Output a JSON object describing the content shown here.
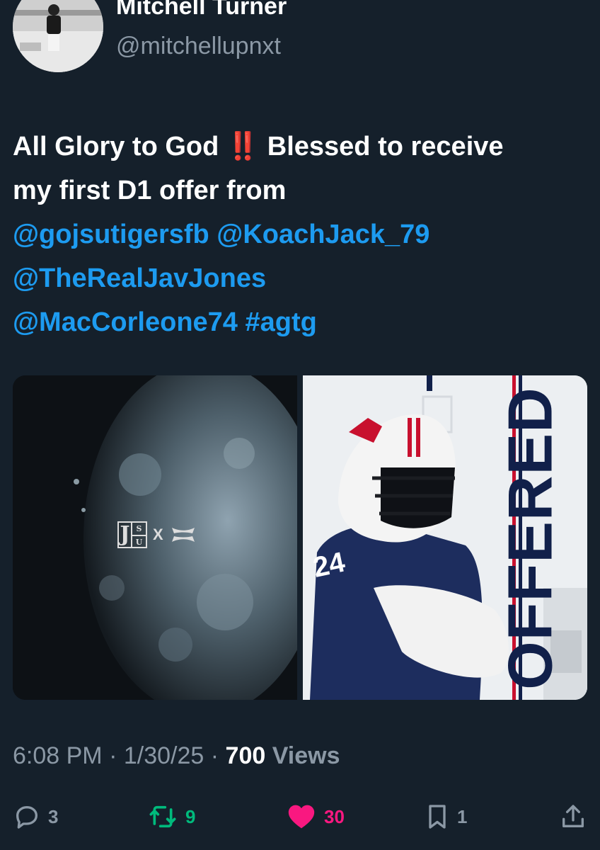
{
  "author": {
    "display_name": "Mitchell Turner",
    "handle": "@mitchellupnxt"
  },
  "tweet": {
    "line1_a": "All Glory to God",
    "line1_emoji": "‼️",
    "line1_b": " Blessed to receive",
    "line2": "my first D1 offer from",
    "mention1": "@gojsutigersfb",
    "mention2": "@KoachJack_79",
    "mention3": "@TheRealJavJones",
    "mention4": "@MacCorleone74",
    "hashtag": "#agtg"
  },
  "media": {
    "left_logo": {
      "letters": [
        "J",
        "S",
        "U"
      ],
      "x": "X"
    },
    "right_banner": "OFFERED",
    "jersey_number": "24"
  },
  "meta": {
    "time": "6:08 PM",
    "date": "1/30/25",
    "sep": "·",
    "views_count": "700",
    "views_label": "Views"
  },
  "actions": {
    "replies": "3",
    "reposts": "9",
    "likes": "30",
    "bookmarks": "1"
  },
  "colors": {
    "background": "#15202b",
    "link": "#1d9bf0",
    "repost": "#00ba7c",
    "like": "#f91880",
    "muted": "#8b98a5"
  },
  "icons": [
    "reply-icon",
    "repost-icon",
    "heart-icon",
    "bookmark-icon",
    "share-icon"
  ]
}
